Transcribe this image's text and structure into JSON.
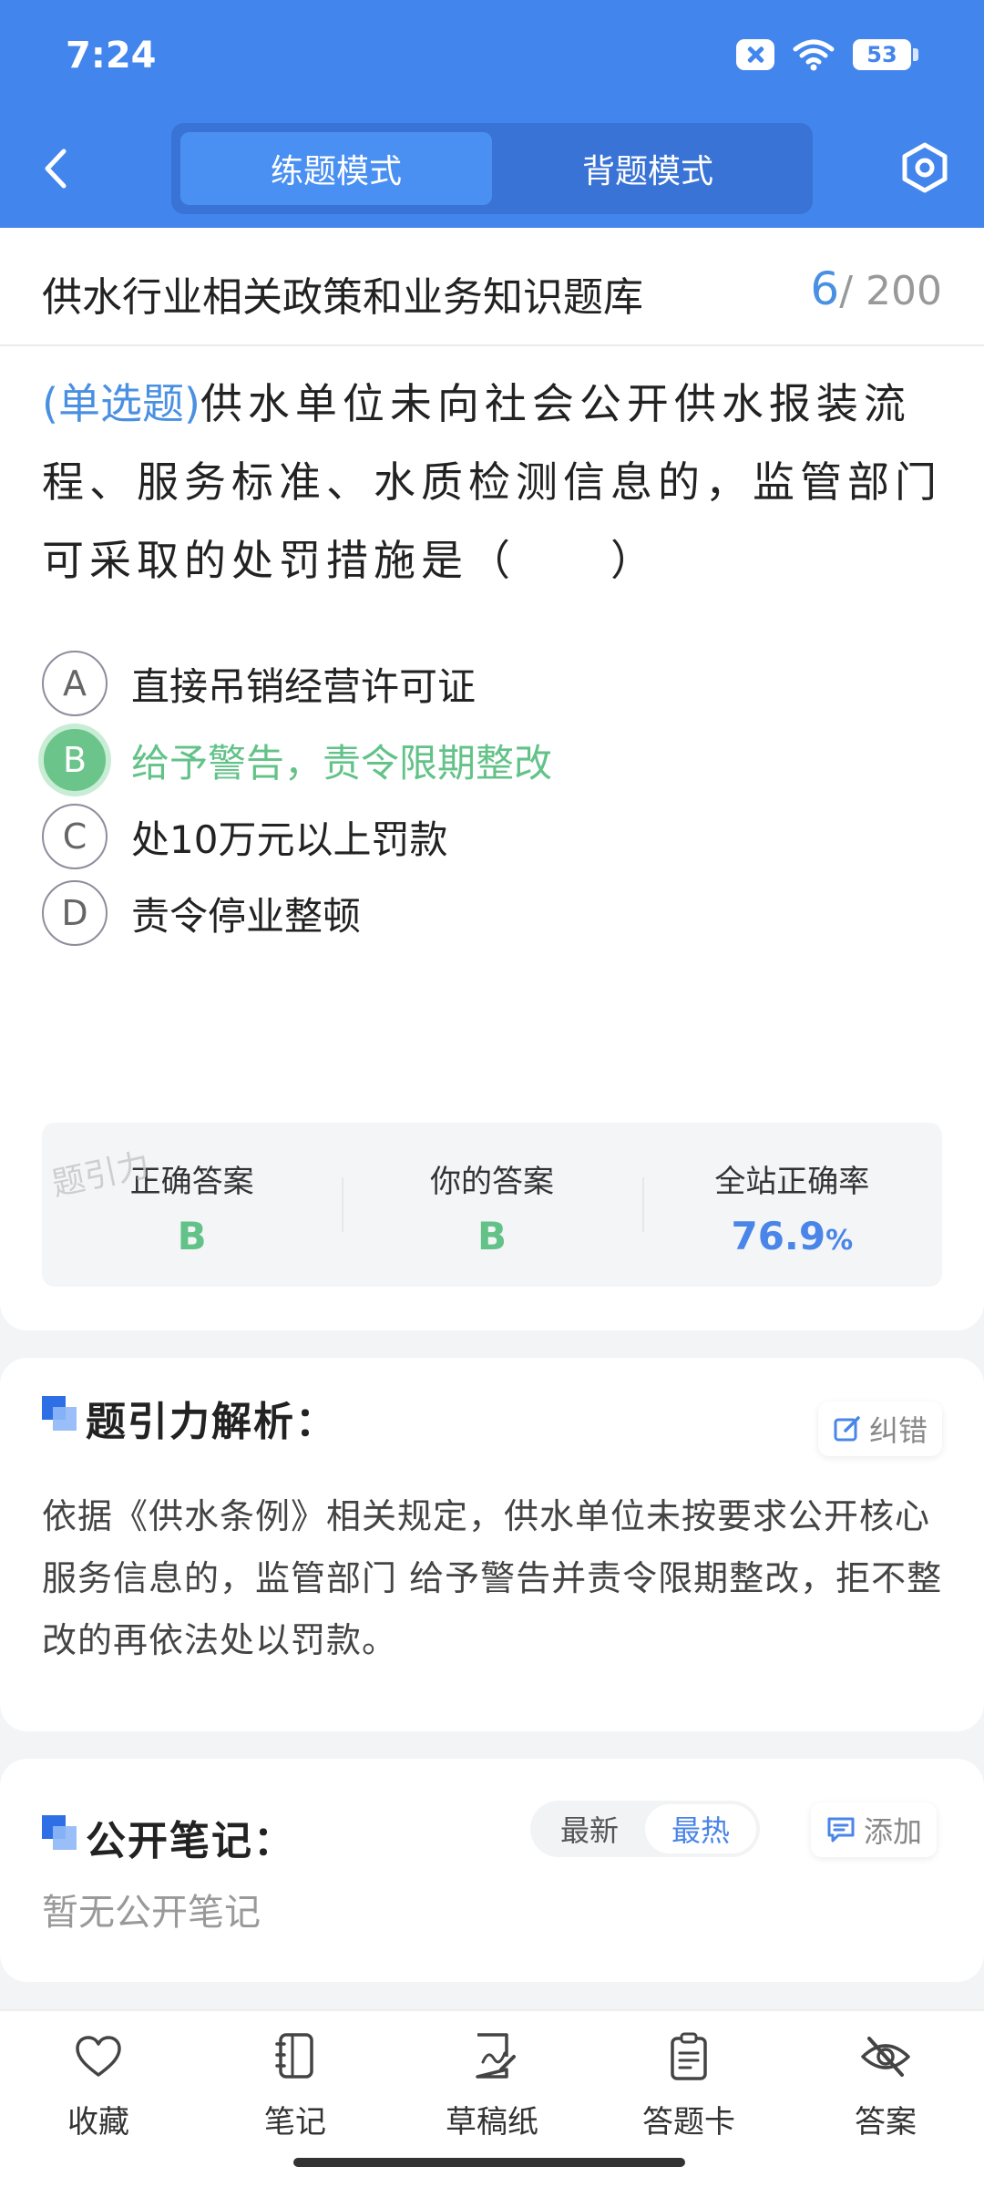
{
  "status_bar": {
    "time": "7:24",
    "battery": "53"
  },
  "header": {
    "tabs": [
      {
        "label": "练题模式",
        "active": true
      },
      {
        "label": "背题模式",
        "active": false
      }
    ]
  },
  "question_bank": {
    "title": "供水行业相关政策和业务知识题库",
    "current": "6",
    "total": "/ 200"
  },
  "question": {
    "type": "(单选题)",
    "text": "供水单位未向社会公开供水报装流程、服务标准、水质检测信息的，监管部门可采取的处罚措施是（　　）"
  },
  "options": [
    {
      "letter": "A",
      "text": "直接吊销经营许可证"
    },
    {
      "letter": "B",
      "text": "给予警告，责令限期整改"
    },
    {
      "letter": "C",
      "text": "处10万元以上罚款"
    },
    {
      "letter": "D",
      "text": "责令停业整顿"
    }
  ],
  "watermark": "题引力",
  "answer_stats": {
    "correct_label": "正确答案",
    "correct_value": "B",
    "yours_label": "你的答案",
    "yours_value": "B",
    "rate_label": "全站正确率",
    "rate_value": "76.9",
    "rate_unit": "%"
  },
  "analysis": {
    "title": "题引力解析：",
    "report_label": "纠错",
    "text": "依据《供水条例》相关规定，供水单位未按要求公开核心服务信息的，监管部门 给予警告并责令限期整改，拒不整改的再依法处以罚款。"
  },
  "notes": {
    "title": "公开笔记：",
    "sort_options": [
      "最新",
      "最热"
    ],
    "add_label": "添加",
    "empty_text": "暂无公开笔记"
  },
  "bottom_nav": [
    {
      "label": "收藏",
      "icon": "heart-icon"
    },
    {
      "label": "笔记",
      "icon": "notebook-icon"
    },
    {
      "label": "草稿纸",
      "icon": "draft-icon"
    },
    {
      "label": "答题卡",
      "icon": "clipboard-icon"
    },
    {
      "label": "答案",
      "icon": "eye-off-icon"
    }
  ],
  "colors": {
    "primary": "#4285ec",
    "correct": "#62c288",
    "accent_blue": "#4a85e8"
  }
}
